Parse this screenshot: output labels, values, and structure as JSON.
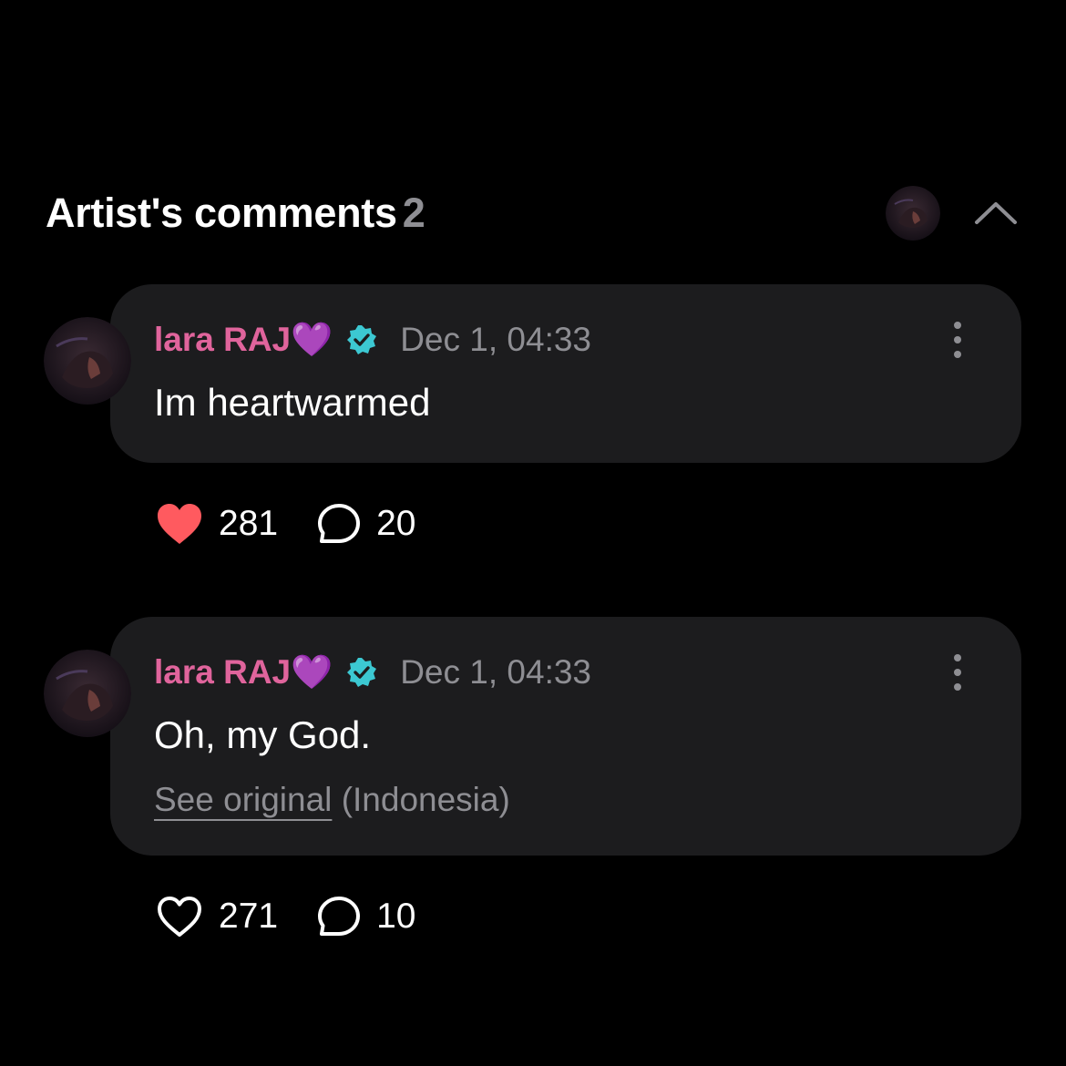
{
  "colors": {
    "background": "#000000",
    "bubble": "#1c1c1e",
    "author_name": "#e0649c",
    "muted": "#8e8e93",
    "verified": "#3cc8d2",
    "liked_heart": "#ff5a5f"
  },
  "section": {
    "title": "Artist's comments",
    "count": "2",
    "collapse_icon": "chevron-up-icon"
  },
  "comments": [
    {
      "author": "lara RAJ💜",
      "verified": true,
      "timestamp": "Dec 1, 04:33",
      "text": "Im heartwarmed",
      "likes": "281",
      "liked": true,
      "replies": "20"
    },
    {
      "author": "lara RAJ💜",
      "verified": true,
      "timestamp": "Dec 1, 04:33",
      "text": "Oh, my God.",
      "see_original_label": "See original",
      "original_language": "(Indonesia)",
      "likes": "271",
      "liked": false,
      "replies": "10"
    }
  ]
}
